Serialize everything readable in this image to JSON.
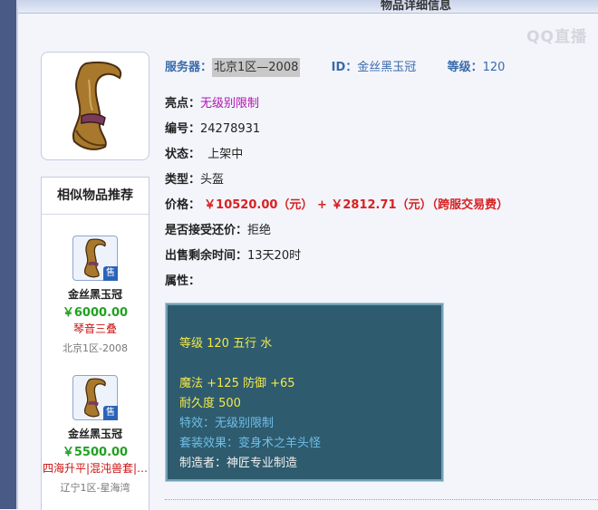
{
  "header": {
    "title": "物品详细信息"
  },
  "watermark": "QQ直播",
  "item": {
    "server_label": "服务器：",
    "server_value": "北京1区—2008",
    "id_label": "ID：",
    "id_value": "金丝黑玉冠",
    "level_label": "等级：",
    "level_value": "120",
    "highlight_label": "亮点：",
    "highlight_value": "无级别限制",
    "number_label": "编号：",
    "number_value": "24278931",
    "status_label": "状态：",
    "status_value": "上架中",
    "type_label": "类型：",
    "type_value": "头盔",
    "price_label": "价格：",
    "price_value": "￥10520.00（元）  +  ￥2812.71（元）（跨服交易费）",
    "counter_label": "是否接受还价：",
    "counter_value": "拒绝",
    "remaining_label": "出售剩余时间：",
    "remaining_value": "13天20时",
    "attr_label": "属性："
  },
  "attributes": {
    "line1": "等级 120 五行 水",
    "line2": "魔法 +125 防御 +65",
    "line3": "耐久度 500",
    "line4": "特效：无级别限制",
    "line5": "套装效果：变身术之羊头怪",
    "line6": "制造者：神匠专业制造"
  },
  "similar": {
    "title": "相似物品推荐",
    "items": [
      {
        "name": "金丝黑玉冠",
        "price": "￥6000.00",
        "tag": "琴音三叠",
        "server": "北京1区-2008",
        "badge": "售"
      },
      {
        "name": "金丝黑玉冠",
        "price": "￥5500.00",
        "tag": "四海升平|混沌兽套|…",
        "server": "辽宁1区-星海湾",
        "badge": "售"
      }
    ]
  },
  "icons": {
    "item": "helmet-icon",
    "badge": "sell-badge"
  },
  "colors": {
    "accent_blue": "#3a6aaa",
    "price_red": "#d62222",
    "attr_bg": "#2e5b6e",
    "highlight": "#b012b0"
  }
}
